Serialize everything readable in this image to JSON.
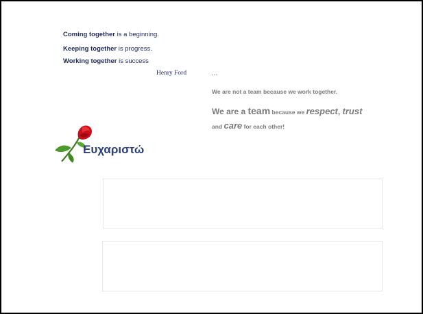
{
  "quotes": [
    {
      "bold": "Coming together",
      "rest": " is a beginning."
    },
    {
      "bold": "Keeping together",
      "rest": " is progress."
    },
    {
      "bold": "Working together",
      "rest": " is success"
    }
  ],
  "author": "Henry Ford",
  "ellipsis": "…",
  "team": {
    "line1": "We are not a team because we work together.",
    "we_are_a": "We are a ",
    "team_word": "team",
    "because_we": " because we ",
    "respect": "respect",
    "comma": ", ",
    "trust": "trust",
    "and": "and ",
    "care": "care",
    "for_each_other": " for each other!"
  },
  "thanks": "Ευχαριστώ",
  "icons": {
    "rose": "rose-image"
  },
  "colors": {
    "quote_text": "#1f2a5a",
    "team_text": "#7a7a7a",
    "thanks_text": "#2c3f7c",
    "rose_red": "#c8101a"
  }
}
